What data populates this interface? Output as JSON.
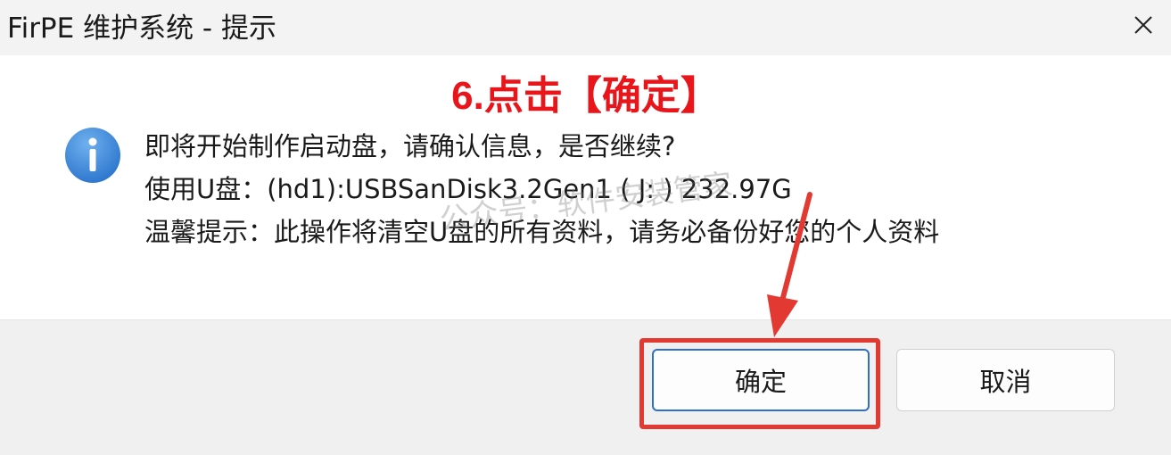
{
  "window": {
    "title": "FirPE 维护系统 - 提示",
    "close_icon": "close-icon"
  },
  "annotation": {
    "text": "6.点击【确定】",
    "color": "#e8151b"
  },
  "message": {
    "icon": "info-icon",
    "line1": "即将开始制作启动盘，请确认信息，是否继续?",
    "line2": "使用U盘：(hd1):USBSanDisk3.2Gen1 ( J: ) 232.97G",
    "line3": "温馨提示：此操作将清空U盘的所有资料，请务必备份好您的个人资料"
  },
  "watermark": {
    "text": "公众号：软件安装管家"
  },
  "buttons": {
    "ok_label": "确定",
    "cancel_label": "取消"
  },
  "colors": {
    "accent": "#2f6fc9",
    "highlight": "#e23a32",
    "info_icon": "#3a86d6"
  }
}
